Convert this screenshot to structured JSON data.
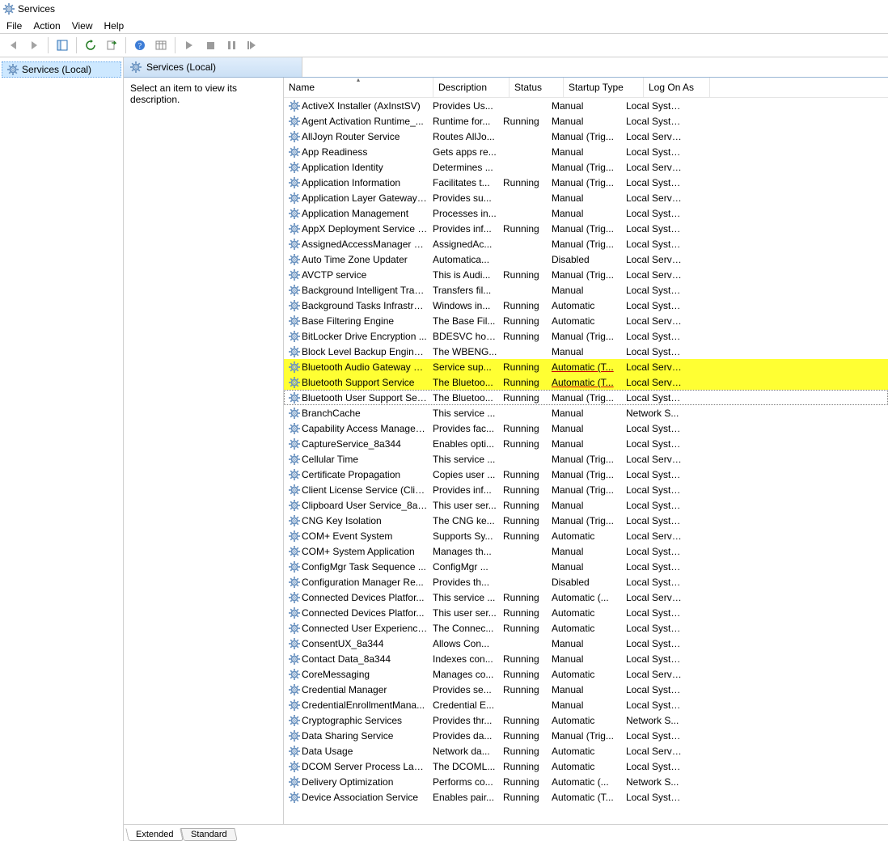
{
  "window_title": "Services",
  "menubar": [
    "File",
    "Action",
    "View",
    "Help"
  ],
  "tree": {
    "root": "Services (Local)"
  },
  "pane_title": "Services (Local)",
  "description_placeholder": "Select an item to view its description.",
  "columns": {
    "name": "Name",
    "description": "Description",
    "status": "Status",
    "startup": "Startup Type",
    "logon": "Log On As"
  },
  "sort_indicator": "col-name",
  "bottom_tabs": {
    "extended": "Extended",
    "standard": "Standard",
    "active": "extended"
  },
  "services": [
    {
      "name": "ActiveX Installer (AxInstSV)",
      "desc": "Provides Us...",
      "status": "",
      "startup": "Manual",
      "logon": "Local Syste...",
      "hl": false
    },
    {
      "name": "Agent Activation Runtime_...",
      "desc": "Runtime for...",
      "status": "Running",
      "startup": "Manual",
      "logon": "Local Syste...",
      "hl": false
    },
    {
      "name": "AllJoyn Router Service",
      "desc": "Routes AllJo...",
      "status": "",
      "startup": "Manual (Trig...",
      "logon": "Local Service",
      "hl": false
    },
    {
      "name": "App Readiness",
      "desc": "Gets apps re...",
      "status": "",
      "startup": "Manual",
      "logon": "Local Syste...",
      "hl": false
    },
    {
      "name": "Application Identity",
      "desc": "Determines ...",
      "status": "",
      "startup": "Manual (Trig...",
      "logon": "Local Service",
      "hl": false
    },
    {
      "name": "Application Information",
      "desc": "Facilitates t...",
      "status": "Running",
      "startup": "Manual (Trig...",
      "logon": "Local Syste...",
      "hl": false
    },
    {
      "name": "Application Layer Gateway ...",
      "desc": "Provides su...",
      "status": "",
      "startup": "Manual",
      "logon": "Local Service",
      "hl": false
    },
    {
      "name": "Application Management",
      "desc": "Processes in...",
      "status": "",
      "startup": "Manual",
      "logon": "Local Syste...",
      "hl": false
    },
    {
      "name": "AppX Deployment Service (...",
      "desc": "Provides inf...",
      "status": "Running",
      "startup": "Manual (Trig...",
      "logon": "Local Syste...",
      "hl": false
    },
    {
      "name": "AssignedAccessManager Se...",
      "desc": "AssignedAc...",
      "status": "",
      "startup": "Manual (Trig...",
      "logon": "Local Syste...",
      "hl": false
    },
    {
      "name": "Auto Time Zone Updater",
      "desc": "Automatica...",
      "status": "",
      "startup": "Disabled",
      "logon": "Local Service",
      "hl": false
    },
    {
      "name": "AVCTP service",
      "desc": "This is Audi...",
      "status": "Running",
      "startup": "Manual (Trig...",
      "logon": "Local Service",
      "hl": false
    },
    {
      "name": "Background Intelligent Tran...",
      "desc": "Transfers fil...",
      "status": "",
      "startup": "Manual",
      "logon": "Local Syste...",
      "hl": false
    },
    {
      "name": "Background Tasks Infrastruc...",
      "desc": "Windows in...",
      "status": "Running",
      "startup": "Automatic",
      "logon": "Local Syste...",
      "hl": false
    },
    {
      "name": "Base Filtering Engine",
      "desc": "The Base Fil...",
      "status": "Running",
      "startup": "Automatic",
      "logon": "Local Service",
      "hl": false
    },
    {
      "name": "BitLocker Drive Encryption ...",
      "desc": "BDESVC hos...",
      "status": "Running",
      "startup": "Manual (Trig...",
      "logon": "Local Syste...",
      "hl": false
    },
    {
      "name": "Block Level Backup Engine ...",
      "desc": "The WBENG...",
      "status": "",
      "startup": "Manual",
      "logon": "Local Syste...",
      "hl": false
    },
    {
      "name": "Bluetooth Audio Gateway S...",
      "desc": "Service sup...",
      "status": "Running",
      "startup": "Automatic (T...",
      "logon": "Local Service",
      "hl": true
    },
    {
      "name": "Bluetooth Support Service",
      "desc": "The Bluetoo...",
      "status": "Running",
      "startup": "Automatic (T...",
      "logon": "Local Service",
      "hl": true
    },
    {
      "name": "Bluetooth User Support Ser...",
      "desc": "The Bluetoo...",
      "status": "Running",
      "startup": "Manual (Trig...",
      "logon": "Local Syste...",
      "hl": false,
      "focused": true
    },
    {
      "name": "BranchCache",
      "desc": "This service ...",
      "status": "",
      "startup": "Manual",
      "logon": "Network S...",
      "hl": false
    },
    {
      "name": "Capability Access Manager ...",
      "desc": "Provides fac...",
      "status": "Running",
      "startup": "Manual",
      "logon": "Local Syste...",
      "hl": false
    },
    {
      "name": "CaptureService_8a344",
      "desc": "Enables opti...",
      "status": "Running",
      "startup": "Manual",
      "logon": "Local Syste...",
      "hl": false
    },
    {
      "name": "Cellular Time",
      "desc": "This service ...",
      "status": "",
      "startup": "Manual (Trig...",
      "logon": "Local Service",
      "hl": false
    },
    {
      "name": "Certificate Propagation",
      "desc": "Copies user ...",
      "status": "Running",
      "startup": "Manual (Trig...",
      "logon": "Local Syste...",
      "hl": false
    },
    {
      "name": "Client License Service (ClipS...",
      "desc": "Provides inf...",
      "status": "Running",
      "startup": "Manual (Trig...",
      "logon": "Local Syste...",
      "hl": false
    },
    {
      "name": "Clipboard User Service_8a344",
      "desc": "This user ser...",
      "status": "Running",
      "startup": "Manual",
      "logon": "Local Syste...",
      "hl": false
    },
    {
      "name": "CNG Key Isolation",
      "desc": "The CNG ke...",
      "status": "Running",
      "startup": "Manual (Trig...",
      "logon": "Local Syste...",
      "hl": false
    },
    {
      "name": "COM+ Event System",
      "desc": "Supports Sy...",
      "status": "Running",
      "startup": "Automatic",
      "logon": "Local Service",
      "hl": false
    },
    {
      "name": "COM+ System Application",
      "desc": "Manages th...",
      "status": "",
      "startup": "Manual",
      "logon": "Local Syste...",
      "hl": false
    },
    {
      "name": "ConfigMgr Task Sequence ...",
      "desc": "ConfigMgr ...",
      "status": "",
      "startup": "Manual",
      "logon": "Local Syste...",
      "hl": false
    },
    {
      "name": "Configuration Manager Re...",
      "desc": "Provides th...",
      "status": "",
      "startup": "Disabled",
      "logon": "Local Syste...",
      "hl": false
    },
    {
      "name": "Connected Devices Platfor...",
      "desc": "This service ...",
      "status": "Running",
      "startup": "Automatic (...",
      "logon": "Local Service",
      "hl": false
    },
    {
      "name": "Connected Devices Platfor...",
      "desc": "This user ser...",
      "status": "Running",
      "startup": "Automatic",
      "logon": "Local Syste...",
      "hl": false
    },
    {
      "name": "Connected User Experience...",
      "desc": "The Connec...",
      "status": "Running",
      "startup": "Automatic",
      "logon": "Local Syste...",
      "hl": false
    },
    {
      "name": "ConsentUX_8a344",
      "desc": "Allows Con...",
      "status": "",
      "startup": "Manual",
      "logon": "Local Syste...",
      "hl": false
    },
    {
      "name": "Contact Data_8a344",
      "desc": "Indexes con...",
      "status": "Running",
      "startup": "Manual",
      "logon": "Local Syste...",
      "hl": false
    },
    {
      "name": "CoreMessaging",
      "desc": "Manages co...",
      "status": "Running",
      "startup": "Automatic",
      "logon": "Local Service",
      "hl": false
    },
    {
      "name": "Credential Manager",
      "desc": "Provides se...",
      "status": "Running",
      "startup": "Manual",
      "logon": "Local Syste...",
      "hl": false
    },
    {
      "name": "CredentialEnrollmentMana...",
      "desc": "Credential E...",
      "status": "",
      "startup": "Manual",
      "logon": "Local Syste...",
      "hl": false
    },
    {
      "name": "Cryptographic Services",
      "desc": "Provides thr...",
      "status": "Running",
      "startup": "Automatic",
      "logon": "Network S...",
      "hl": false
    },
    {
      "name": "Data Sharing Service",
      "desc": "Provides da...",
      "status": "Running",
      "startup": "Manual (Trig...",
      "logon": "Local Syste...",
      "hl": false
    },
    {
      "name": "Data Usage",
      "desc": "Network da...",
      "status": "Running",
      "startup": "Automatic",
      "logon": "Local Service",
      "hl": false
    },
    {
      "name": "DCOM Server Process Laun...",
      "desc": "The DCOML...",
      "status": "Running",
      "startup": "Automatic",
      "logon": "Local Syste...",
      "hl": false
    },
    {
      "name": "Delivery Optimization",
      "desc": "Performs co...",
      "status": "Running",
      "startup": "Automatic (...",
      "logon": "Network S...",
      "hl": false
    },
    {
      "name": "Device Association Service",
      "desc": "Enables pair...",
      "status": "Running",
      "startup": "Automatic (T...",
      "logon": "Local Syste...",
      "hl": false
    }
  ]
}
